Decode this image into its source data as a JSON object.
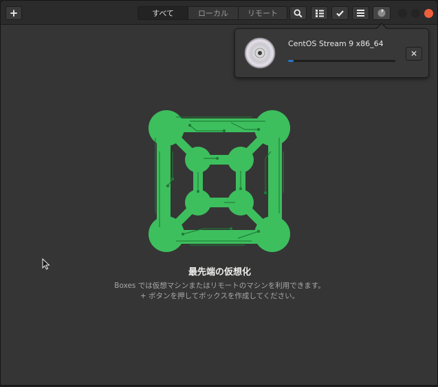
{
  "headerbar": {
    "new_button_label": "+",
    "tabs": [
      {
        "label": "すべて",
        "active": true
      },
      {
        "label": "ローカル",
        "active": false
      },
      {
        "label": "リモート",
        "active": false
      }
    ],
    "icons": [
      "search-icon",
      "view-list-icon",
      "selection-check-icon",
      "menu-icon",
      "downloads-icon"
    ],
    "window_controls": [
      "minimize",
      "maximize",
      "close"
    ],
    "close_color": "#f05f3b"
  },
  "popover": {
    "vm_name": "CentOS Stream 9 x86_64",
    "progress": 0.05,
    "close_label": "✕",
    "media_icon": "cd-icon"
  },
  "empty_state": {
    "title": "最先端の仮想化",
    "line1": "Boxes では仮想マシンまたはリモートのマシンを利用できます。",
    "line2": "+ ボタンを押してボックスを作成してください。",
    "logo_color": "#3dbf5e"
  }
}
